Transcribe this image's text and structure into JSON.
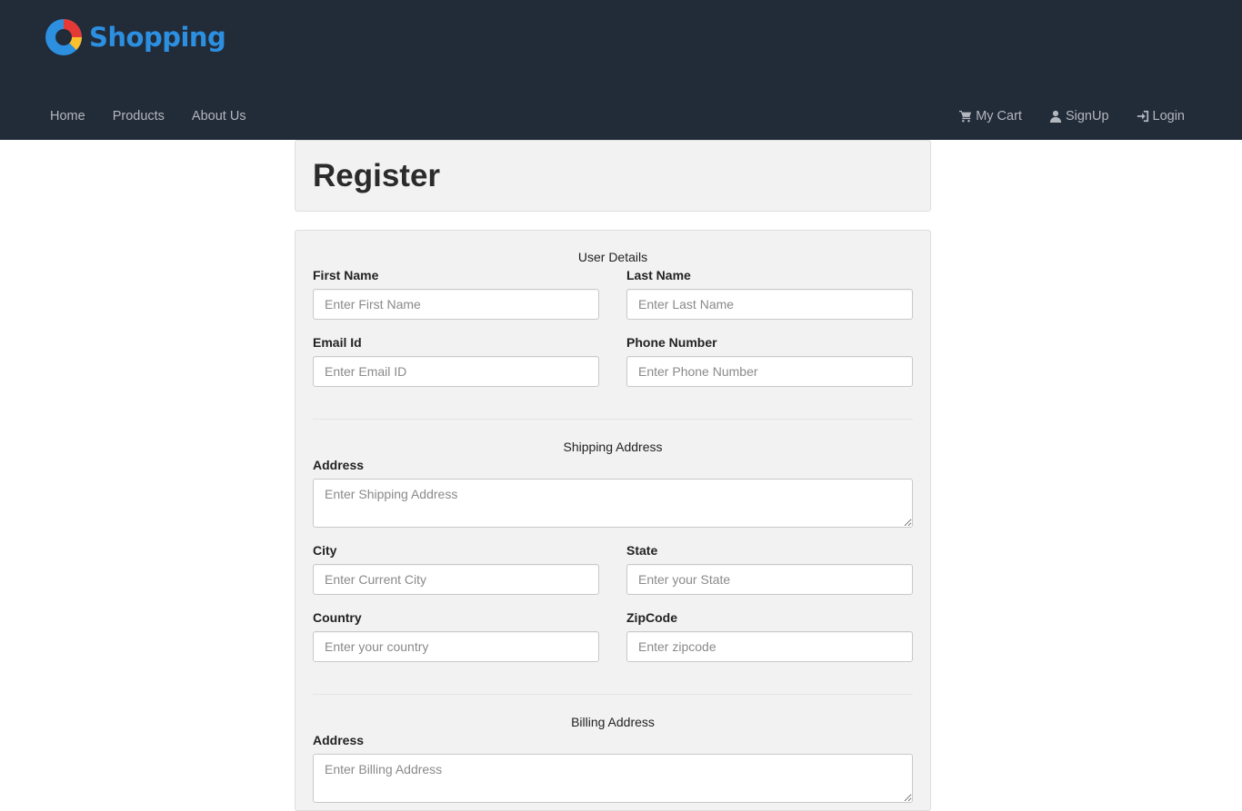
{
  "brand": {
    "name": "Shopping"
  },
  "nav": {
    "left": [
      {
        "label": "Home"
      },
      {
        "label": "Products"
      },
      {
        "label": "About Us"
      }
    ],
    "right": [
      {
        "label": "My Cart",
        "icon": "cart-icon"
      },
      {
        "label": "SignUp",
        "icon": "user-icon"
      },
      {
        "label": "Login",
        "icon": "login-icon"
      }
    ]
  },
  "page": {
    "title": "Register"
  },
  "user_details": {
    "heading": "User Details",
    "first_name": {
      "label": "First Name",
      "placeholder": "Enter First Name"
    },
    "last_name": {
      "label": "Last Name",
      "placeholder": "Enter Last Name"
    },
    "email": {
      "label": "Email Id",
      "placeholder": "Enter Email ID"
    },
    "phone": {
      "label": "Phone Number",
      "placeholder": "Enter Phone Number"
    }
  },
  "shipping": {
    "heading": "Shipping Address",
    "address": {
      "label": "Address",
      "placeholder": "Enter Shipping Address"
    },
    "city": {
      "label": "City",
      "placeholder": "Enter Current City"
    },
    "state": {
      "label": "State",
      "placeholder": "Enter your State"
    },
    "country": {
      "label": "Country",
      "placeholder": "Enter your country"
    },
    "zipcode": {
      "label": "ZipCode",
      "placeholder": "Enter zipcode"
    }
  },
  "billing": {
    "heading": "Billing Address",
    "address": {
      "label": "Address",
      "placeholder": "Enter Billing Address"
    }
  },
  "colors": {
    "header_bg": "#222b38",
    "brand_blue": "#2c8fe0",
    "nav_text": "#b3b8bf",
    "panel_bg": "#f2f2f2"
  }
}
